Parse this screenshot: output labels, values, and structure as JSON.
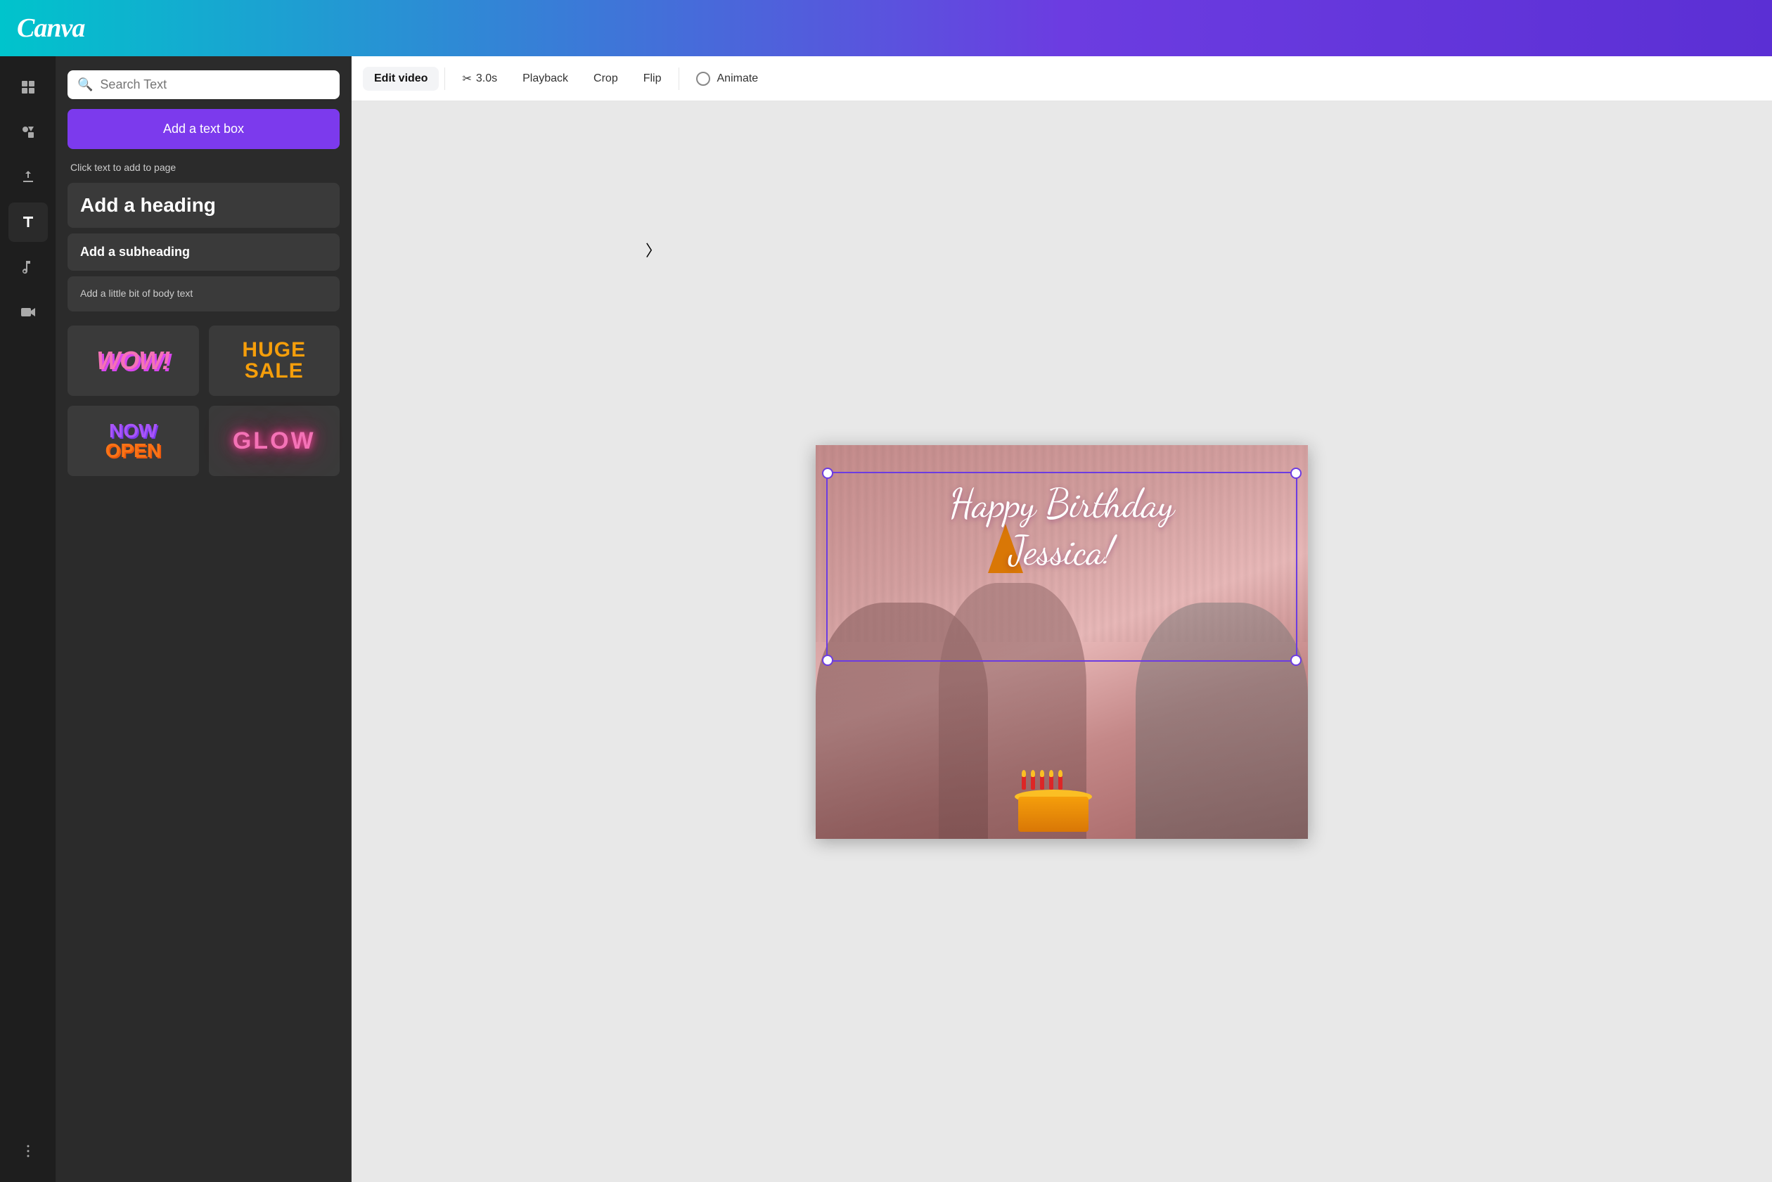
{
  "header": {
    "logo": "Canva"
  },
  "sidebar": {
    "icons": [
      {
        "name": "templates-icon",
        "symbol": "⊞",
        "label": "Templates"
      },
      {
        "name": "elements-icon",
        "symbol": "◇",
        "label": "Elements"
      },
      {
        "name": "uploads-icon",
        "symbol": "↑",
        "label": "Uploads"
      },
      {
        "name": "text-icon",
        "symbol": "T",
        "label": "Text"
      },
      {
        "name": "audio-icon",
        "symbol": "♫",
        "label": "Audio"
      },
      {
        "name": "video-icon",
        "symbol": "▶",
        "label": "Video"
      },
      {
        "name": "more-icon",
        "symbol": "…",
        "label": "More"
      }
    ]
  },
  "text_panel": {
    "search": {
      "placeholder": "Search Text"
    },
    "add_textbox_label": "Add a text box",
    "instruction": "Click text to add to page",
    "text_styles": [
      {
        "id": "heading",
        "label": "Add a heading",
        "style": "heading"
      },
      {
        "id": "subheading",
        "label": "Add a subheading",
        "style": "subheading"
      },
      {
        "id": "body",
        "label": "Add a little bit of body text",
        "style": "body"
      }
    ],
    "style_examples": [
      {
        "id": "wow",
        "label": "WOW!"
      },
      {
        "id": "huge-sale",
        "label": "HUGE SALE"
      },
      {
        "id": "now-open",
        "label": "NOW OPEN"
      },
      {
        "id": "glow",
        "label": "GLOW"
      }
    ]
  },
  "toolbar": {
    "buttons": [
      {
        "id": "edit-video",
        "label": "Edit video",
        "active": true
      },
      {
        "id": "duration",
        "label": "3.0s"
      },
      {
        "id": "playback",
        "label": "Playback"
      },
      {
        "id": "crop",
        "label": "Crop"
      },
      {
        "id": "flip",
        "label": "Flip"
      },
      {
        "id": "animate",
        "label": "Animate"
      }
    ]
  },
  "canvas": {
    "birthday_line1": "Happy Birthday",
    "birthday_line2": "Jessica!"
  }
}
